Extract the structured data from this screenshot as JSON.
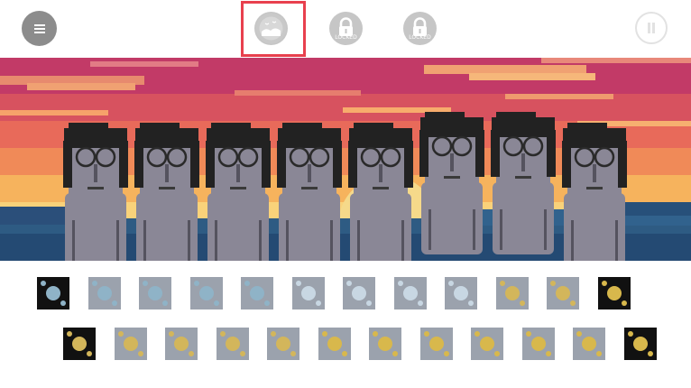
{
  "app": {
    "menu_icon": "hamburger-icon",
    "pause_icon": "pause-icon"
  },
  "bonuses": [
    {
      "state": "active",
      "icon": "sunset-landscape-icon"
    },
    {
      "state": "locked",
      "icon": "lock-icon",
      "label": "LOCKED"
    },
    {
      "state": "locked",
      "icon": "lock-icon",
      "label": "LOCKED"
    }
  ],
  "colors": {
    "highlight": "#e8404e",
    "character_skin": "#8a8796",
    "sky_top": "#c23a67",
    "sun": "#f5d98a"
  },
  "performers_count": 8,
  "sound_icons": {
    "row1": [
      {
        "type": "beat",
        "icon": "neon-bar-icon"
      },
      {
        "type": "beat",
        "icon": "bubbles-icon"
      },
      {
        "type": "beat",
        "icon": "curtain-icon"
      },
      {
        "type": "beat",
        "icon": "dots-icon"
      },
      {
        "type": "beat",
        "icon": "skull-icon"
      },
      {
        "type": "effects",
        "icon": "anchor-icon"
      },
      {
        "type": "effects",
        "icon": "dark-screen-icon"
      },
      {
        "type": "effects",
        "icon": "orb-icon"
      },
      {
        "type": "effects",
        "icon": "helmet-icon"
      },
      {
        "type": "melody",
        "icon": "padlock-icon"
      },
      {
        "type": "melody",
        "icon": "candy-icon"
      },
      {
        "type": "voice",
        "icon": "spark-icon"
      }
    ],
    "row2": [
      {
        "type": "melody",
        "icon": "cage-icon"
      },
      {
        "type": "melody",
        "icon": "umbrella-icon"
      },
      {
        "type": "melody",
        "icon": "gold-grid-icon"
      },
      {
        "type": "melody",
        "icon": "hammer-icon"
      },
      {
        "type": "melody",
        "icon": "ring-icon"
      },
      {
        "type": "voice",
        "icon": "moon-icon"
      },
      {
        "type": "voice",
        "icon": "sun-icon"
      },
      {
        "type": "voice",
        "icon": "columns-icon"
      },
      {
        "type": "voice",
        "icon": "vase-icon"
      },
      {
        "type": "voice",
        "icon": "arrows-icon"
      },
      {
        "type": "voice",
        "icon": "candy-stick-icon"
      },
      {
        "type": "voice",
        "icon": "gold-swirl-icon"
      }
    ]
  }
}
